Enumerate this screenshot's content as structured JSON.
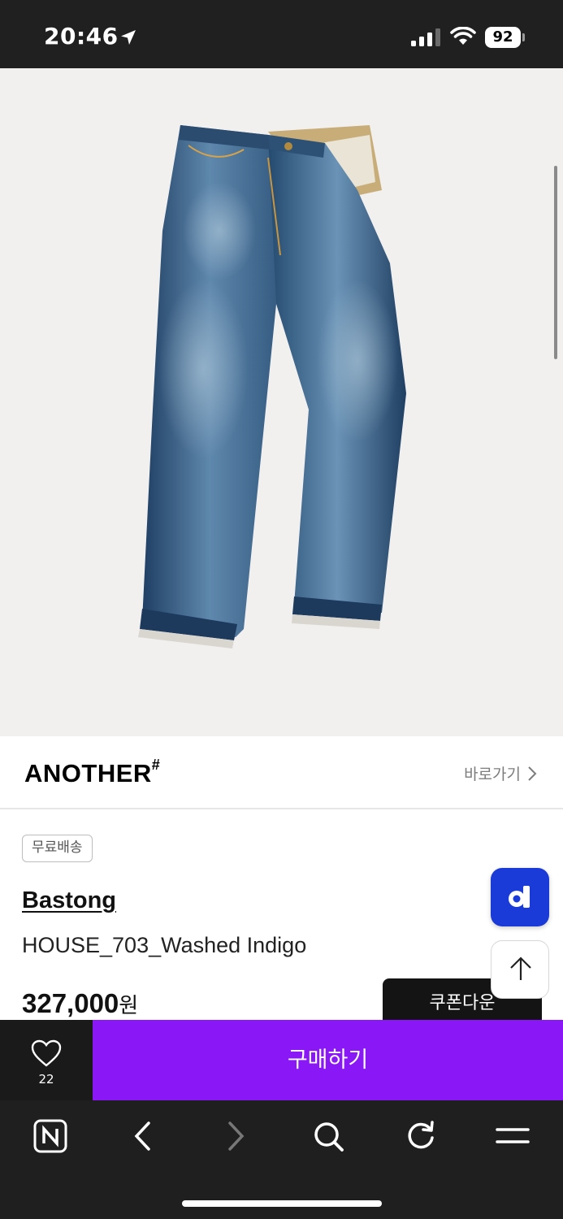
{
  "status_bar": {
    "time": "20:46",
    "battery": "92"
  },
  "brand": {
    "logo": "ANOTHER",
    "logo_mark": "#",
    "link_label": "바로가기"
  },
  "product": {
    "badge": "무료배송",
    "store": "Bastong",
    "name": "HOUSE_703_Washed Indigo",
    "price": "327,000",
    "price_unit": "원",
    "coupon_label": "쿠폰다운"
  },
  "purchase_bar": {
    "like_count": "22",
    "buy_label": "구매하기"
  },
  "colors": {
    "buy_accent": "#8a17f5",
    "floating_button": "#1a3bd7"
  },
  "icons": {
    "floating": "d-logo-icon",
    "scroll_top": "arrow-up-icon",
    "like": "heart-icon",
    "toolbar": [
      "naver-home-icon",
      "back-arrow-icon",
      "forward-arrow-icon",
      "search-icon",
      "refresh-icon",
      "menu-icon"
    ]
  }
}
